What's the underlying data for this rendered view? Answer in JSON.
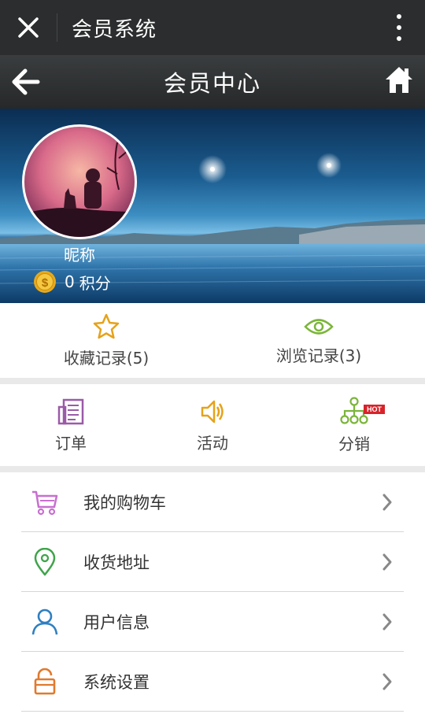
{
  "wechat_bar": {
    "title": "会员系统"
  },
  "header": {
    "title": "会员中心"
  },
  "profile": {
    "nickname": "昵称",
    "points_value": "0",
    "points_unit": "积分"
  },
  "records": [
    {
      "label": "收藏记录(5)",
      "icon": "star-icon"
    },
    {
      "label": "浏览记录(3)",
      "icon": "eye-icon"
    }
  ],
  "quick": [
    {
      "label": "订单",
      "icon": "order-icon"
    },
    {
      "label": "活动",
      "icon": "speaker-icon"
    },
    {
      "label": "分销",
      "icon": "distribution-icon",
      "badge": "HOT"
    }
  ],
  "menu": [
    {
      "label": "我的购物车",
      "icon": "cart-icon"
    },
    {
      "label": "收货地址",
      "icon": "location-pin-icon"
    },
    {
      "label": "用户信息",
      "icon": "user-icon"
    },
    {
      "label": "系统设置",
      "icon": "unlock-icon"
    }
  ],
  "colors": {
    "topbar": "#2b2d2e",
    "star": "#e6a21a",
    "eye": "#7bb53a",
    "order": "#9b5aa8",
    "speaker": "#e6a21a",
    "distribution": "#7bb53a",
    "cart": "#c86fd0",
    "pin": "#3fa44a",
    "user": "#2f7fc1",
    "lock": "#e07a2e",
    "hot": "#d8232a"
  }
}
